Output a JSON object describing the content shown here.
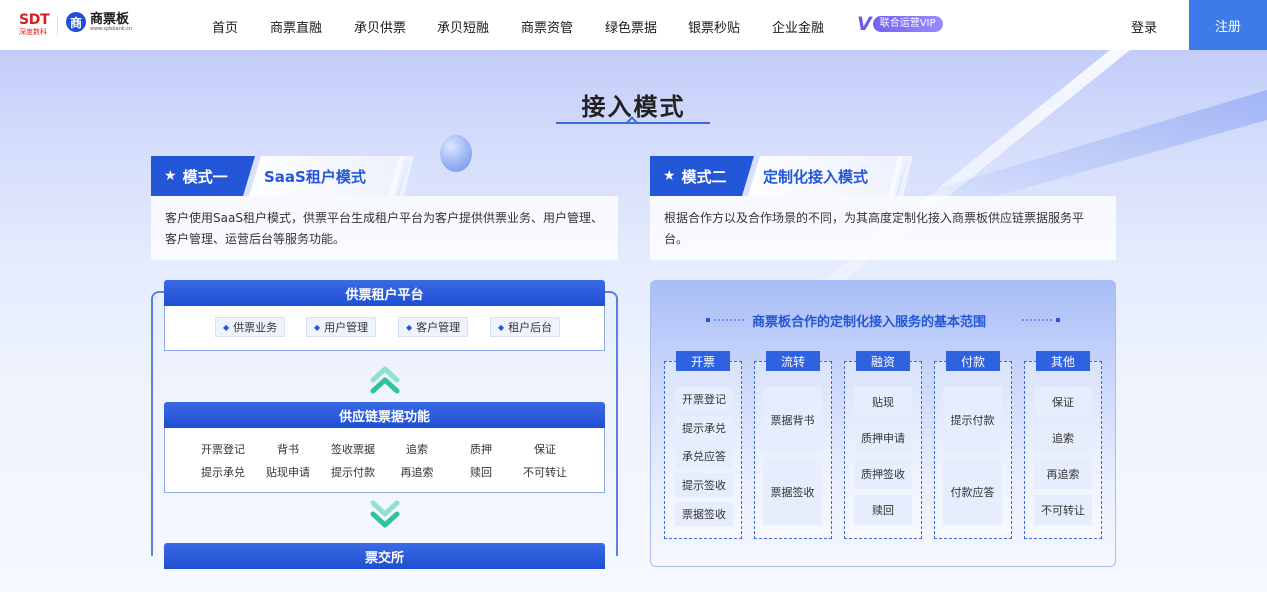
{
  "brand": {
    "sdt_big": "SDT",
    "sdt_small": "深度数科",
    "spb_mark": "商",
    "spb_name": "商票板",
    "spb_url": "www.spbbank.cn"
  },
  "nav": {
    "items": [
      "首页",
      "商票直融",
      "承贝供票",
      "承贝短融",
      "商票资管",
      "绿色票据",
      "银票秒贴",
      "企业金融"
    ],
    "vip_letter": "V",
    "vip_label": "联合运营VIP",
    "login": "登录",
    "register": "注册"
  },
  "section": {
    "title": "接入模式"
  },
  "mode1": {
    "tag": "模式一",
    "name": "SaaS租户模式",
    "desc": "客户使用SaaS租户模式，供票平台生成租户平台为客户提供供票业务、用户管理、客户管理、运营后台等服务功能。",
    "platform_title": "供票租户平台",
    "platform_items": [
      "供票业务",
      "用户管理",
      "客户管理",
      "租户后台"
    ],
    "func_title": "供应链票据功能",
    "func_row1": [
      "开票登记",
      "背书",
      "签收票据",
      "追索",
      "质押",
      "保证"
    ],
    "func_row2": [
      "提示承兑",
      "贴现申请",
      "提示付款",
      "再追索",
      "赎回",
      "不可转让"
    ],
    "exchange_title": "票交所"
  },
  "mode2": {
    "tag": "模式二",
    "name": "定制化接入模式",
    "desc": "根据合作方以及合作场景的不同，为其高度定制化接入商票板供应链票据服务平台。",
    "scope_title": "商票板合作的定制化接入服务的基本范围",
    "columns": [
      {
        "title": "开票",
        "items": [
          "开票登记",
          "提示承兑",
          "承兑应答",
          "提示签收",
          "票据签收"
        ]
      },
      {
        "title": "流转",
        "items": [
          "票据背书",
          "票据签收"
        ]
      },
      {
        "title": "融资",
        "items": [
          "贴现",
          "质押申请",
          "质押签收",
          "赎回"
        ]
      },
      {
        "title": "付款",
        "items": [
          "提示付款",
          "付款应答"
        ]
      },
      {
        "title": "其他",
        "items": [
          "保证",
          "追索",
          "再追索",
          "不可转让"
        ]
      }
    ]
  },
  "colors": {
    "primary": "#2456d8",
    "register_bg": "#3e7bea",
    "accent_green": "#2fc39a"
  }
}
